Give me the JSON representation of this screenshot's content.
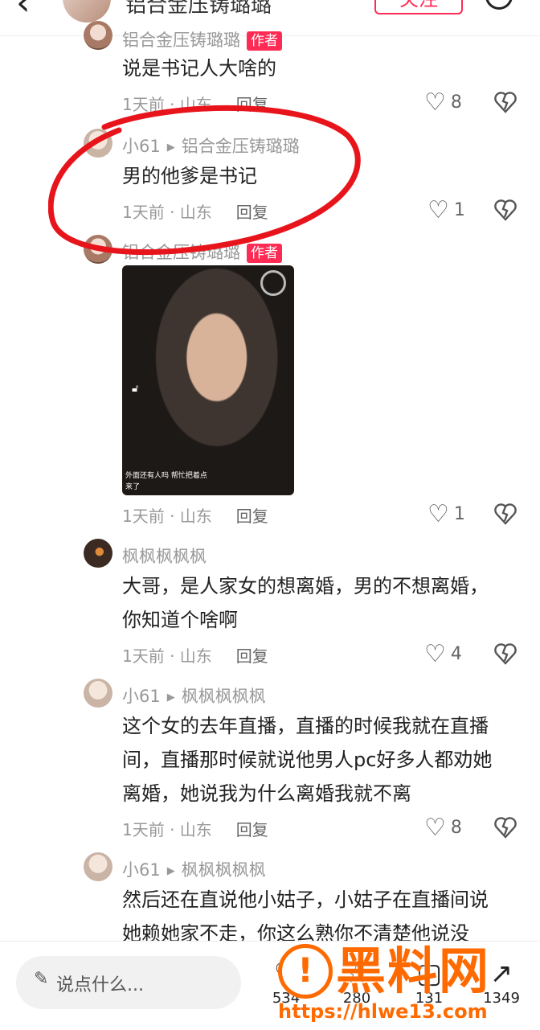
{
  "header": {
    "back_icon": "chevron-left-icon",
    "author_name": "铝合金压铸璐璐",
    "follow_label": "关注",
    "search_icon": "search-icon"
  },
  "comments": [
    {
      "name": "铝合金压铸璐璐",
      "badge": "作者",
      "text": "说是书记人大啥的",
      "time": "1天前 · 山东",
      "reply": "回复",
      "likes": "8"
    },
    {
      "name": "小61",
      "reply_to": "铝合金压铸璐璐",
      "text": "男的他爹是书记",
      "time": "1天前 · 山东",
      "reply": "回复",
      "likes": "1"
    },
    {
      "name": "铝合金压铸璐璐",
      "badge": "作者",
      "image": {
        "caption1": "外面还有人吗 帮忙把着点",
        "caption2": "来了"
      },
      "time": "1天前 · 山东",
      "reply": "回复",
      "likes": "1"
    },
    {
      "name": "枫枫枫枫枫",
      "text_lines": [
        "大哥，是人家女的想离婚，男的不想离婚，",
        "你知道个啥啊"
      ],
      "time": "1天前 · 山东",
      "reply": "回复",
      "likes": "4"
    },
    {
      "name": "小61",
      "reply_to": "枫枫枫枫枫",
      "text_lines": [
        "这个女的去年直播，直播的时候我就在直播",
        "间，直播那时候就说他男人pc好多人都劝她",
        "离婚，她说我为什么离婚我就不离"
      ],
      "time": "1天前 · 山东",
      "reply": "回复",
      "likes": "8"
    },
    {
      "name": "小61",
      "reply_to": "枫枫枫枫枫",
      "text_lines": [
        "然后还在直说他小姑子，小姑子在直播间说",
        "她赖她家不走，你这么熟你不清楚他说没"
      ]
    }
  ],
  "bottom": {
    "placeholder": "说点什么...",
    "actions": [
      {
        "icon": "heart-icon",
        "count": "534"
      },
      {
        "icon": "star-icon",
        "count": "280"
      },
      {
        "icon": "comment-icon",
        "count": "131"
      },
      {
        "icon": "share-icon",
        "count": "1349"
      }
    ]
  },
  "watermark": {
    "brand": "黑料网",
    "url": "https://hlwe13.com"
  },
  "colors": {
    "accent": "#fe2c55",
    "annotation": "#e8141b",
    "watermark": "#ff6a00"
  }
}
